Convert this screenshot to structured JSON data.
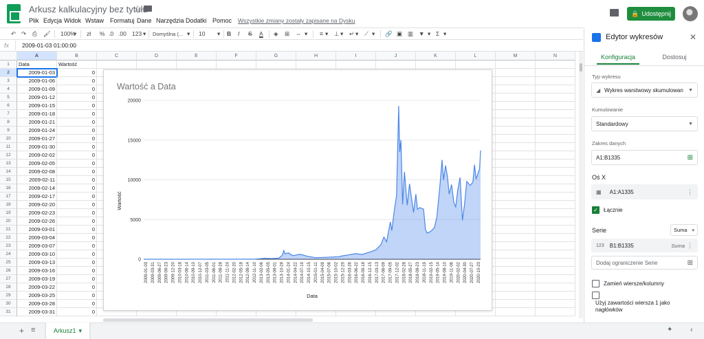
{
  "app": {
    "title": "Arkusz kalkulacyjny bez tytułu",
    "saved_status": "Wszystkie zmiany zostały zapisane na Dysku",
    "share_label": "Udostępnij",
    "menu": [
      "Plik",
      "Edycja",
      "Widok",
      "Wstaw",
      "Formatuj",
      "Dane",
      "Narzędzia",
      "Dodatki",
      "Pomoc"
    ]
  },
  "toolbar": {
    "zoom": "100%",
    "currency": "zł",
    "percent": "%",
    "dec_less": ".0",
    "dec_more": ".00",
    "format": "123",
    "font": "Domyślna (...",
    "font_size": "10",
    "bold": "B",
    "italic": "I",
    "strike": "S",
    "textcolor": "A",
    "sum": "Σ"
  },
  "formula_bar": {
    "fx": "fx",
    "value": "2009-01-03 01:00:00"
  },
  "grid": {
    "columns": [
      "A",
      "B",
      "C",
      "D",
      "E",
      "F",
      "G",
      "H",
      "I",
      "J",
      "K",
      "L",
      "M",
      "N"
    ],
    "header_row": [
      "Data",
      "Wartość"
    ],
    "rows": [
      [
        "2009-01-03",
        "0"
      ],
      [
        "2009-01-06",
        "0"
      ],
      [
        "2009-01-09",
        "0"
      ],
      [
        "2009-01-12",
        "0"
      ],
      [
        "2009-01-15",
        "0"
      ],
      [
        "2009-01-18",
        "0"
      ],
      [
        "2009-01-21",
        "0"
      ],
      [
        "2009-01-24",
        "0"
      ],
      [
        "2009-01-27",
        "0"
      ],
      [
        "2009-01-30",
        "0"
      ],
      [
        "2009-02-02",
        "0"
      ],
      [
        "2009-02-05",
        "0"
      ],
      [
        "2009-02-08",
        "0"
      ],
      [
        "2009-02-11",
        "0"
      ],
      [
        "2009-02-14",
        "0"
      ],
      [
        "2009-02-17",
        "0"
      ],
      [
        "2009-02-20",
        "0"
      ],
      [
        "2009-02-23",
        "0"
      ],
      [
        "2009-02-26",
        "0"
      ],
      [
        "2009-03-01",
        "0"
      ],
      [
        "2009-03-04",
        "0"
      ],
      [
        "2009-03-07",
        "0"
      ],
      [
        "2009-03-10",
        "0"
      ],
      [
        "2009-03-13",
        "0"
      ],
      [
        "2009-03-16",
        "0"
      ],
      [
        "2009-03-19",
        "0"
      ],
      [
        "2009-03-22",
        "0"
      ],
      [
        "2009-03-25",
        "0"
      ],
      [
        "2009-03-28",
        "0"
      ],
      [
        "2009-03-31",
        "0"
      ]
    ]
  },
  "chart_data": {
    "type": "area",
    "title": "Wartość a Data",
    "xlabel": "Data",
    "ylabel": "Wartość",
    "ylim": [
      0,
      20000
    ],
    "yticks": [
      "0",
      "5000",
      "10000",
      "15000",
      "20000"
    ],
    "grid": true,
    "color": "#4a86e8",
    "x_tick_labels": [
      "2009-01-03",
      "2009-03-31",
      "2009-06-27",
      "2009-09-23",
      "2009-12-20",
      "2010-03-18",
      "2010-06-14",
      "2010-09-10",
      "2010-12-07",
      "2011-03-05",
      "2011-06-01",
      "2011-08-28",
      "2011-11-24",
      "2012-02-20",
      "2012-05-18",
      "2012-08-14",
      "2012-11-10",
      "2013-02-06",
      "2013-05-05",
      "2013-08-01",
      "2013-10-28",
      "2014-01-24",
      "2014-04-22",
      "2014-07-19",
      "2014-10-15",
      "2015-01-11",
      "2015-04-09",
      "2015-07-06",
      "2015-10-02",
      "2015-12-29",
      "2016-03-26",
      "2016-06-22",
      "2016-09-18",
      "2016-12-15",
      "2017-03-13",
      "2017-06-09",
      "2017-09-05",
      "2017-12-02",
      "2018-02-28",
      "2018-05-27",
      "2018-08-23",
      "2018-11-19",
      "2019-02-15",
      "2019-05-14",
      "2019-08-10",
      "2019-11-06",
      "2020-02-02",
      "2020-04-30",
      "2020-07-27",
      "2020-10-23"
    ],
    "points": [
      [
        "2009-01-03",
        0
      ],
      [
        "2010-07-01",
        0
      ],
      [
        "2011-06-01",
        15
      ],
      [
        "2011-12-01",
        4
      ],
      [
        "2012-06-01",
        6
      ],
      [
        "2012-12-01",
        13
      ],
      [
        "2013-04-01",
        120
      ],
      [
        "2013-07-01",
        90
      ],
      [
        "2013-10-01",
        140
      ],
      [
        "2013-11-15",
        500
      ],
      [
        "2013-12-05",
        1100
      ],
      [
        "2013-12-20",
        700
      ],
      [
        "2014-02-01",
        800
      ],
      [
        "2014-04-01",
        450
      ],
      [
        "2014-07-01",
        620
      ],
      [
        "2014-10-01",
        380
      ],
      [
        "2015-01-15",
        200
      ],
      [
        "2015-06-01",
        240
      ],
      [
        "2015-11-01",
        320
      ],
      [
        "2016-01-01",
        430
      ],
      [
        "2016-06-15",
        700
      ],
      [
        "2016-09-01",
        600
      ],
      [
        "2016-12-31",
        960
      ],
      [
        "2017-03-01",
        1200
      ],
      [
        "2017-05-01",
        1800
      ],
      [
        "2017-06-10",
        2800
      ],
      [
        "2017-07-15",
        2200
      ],
      [
        "2017-09-01",
        4700
      ],
      [
        "2017-09-20",
        3600
      ],
      [
        "2017-10-20",
        6000
      ],
      [
        "2017-11-20",
        8000
      ],
      [
        "2017-12-17",
        19300
      ],
      [
        "2017-12-30",
        13500
      ],
      [
        "2018-01-15",
        15000
      ],
      [
        "2018-02-05",
        6900
      ],
      [
        "2018-03-01",
        11000
      ],
      [
        "2018-04-05",
        6800
      ],
      [
        "2018-05-05",
        9500
      ],
      [
        "2018-06-25",
        5900
      ],
      [
        "2018-07-25",
        8200
      ],
      [
        "2018-08-15",
        6300
      ],
      [
        "2018-09-15",
        6500
      ],
      [
        "2018-11-01",
        6300
      ],
      [
        "2018-11-25",
        3800
      ],
      [
        "2018-12-15",
        3300
      ],
      [
        "2019-02-01",
        3500
      ],
      [
        "2019-03-20",
        4000
      ],
      [
        "2019-04-20",
        5300
      ],
      [
        "2019-05-25",
        8700
      ],
      [
        "2019-06-26",
        12500
      ],
      [
        "2019-07-15",
        10000
      ],
      [
        "2019-08-10",
        11800
      ],
      [
        "2019-09-05",
        10300
      ],
      [
        "2019-09-25",
        8200
      ],
      [
        "2019-10-26",
        9400
      ],
      [
        "2019-11-25",
        7100
      ],
      [
        "2019-12-18",
        6600
      ],
      [
        "2020-01-15",
        8800
      ],
      [
        "2020-02-12",
        10300
      ],
      [
        "2020-03-13",
        4900
      ],
      [
        "2020-04-10",
        6900
      ],
      [
        "2020-05-08",
        9800
      ],
      [
        "2020-06-20",
        9300
      ],
      [
        "2020-07-25",
        9700
      ],
      [
        "2020-08-15",
        11900
      ],
      [
        "2020-09-05",
        10100
      ],
      [
        "2020-10-20",
        11400
      ],
      [
        "2020-11-01",
        13700
      ]
    ]
  },
  "panel": {
    "title": "Edytor wykresów",
    "tab_config": "Konfiguracja",
    "tab_custom": "Dostosuj",
    "chart_type_label": "Typ wykresu",
    "chart_type_value": "Wykres warstwowy skumulowan",
    "stacking_label": "Kumulowanie",
    "stacking_value": "Standardowy",
    "range_label": "Zakres danych",
    "range_value": "A1:B1335",
    "xaxis_title": "Oś X",
    "xaxis_value": "A1:A1335",
    "aggregate_label": "Łącznie",
    "series_title": "Serie",
    "series_agg": "Suma",
    "series_value": "B1:B1335",
    "series_value_agg": "Suma",
    "add_series_placeholder": "Dodaj ograniczenie Serie",
    "swap_label": "Zamień wiersze/kolumny",
    "header_label": "Użyj zawartości wiersza 1 jako nagłówków"
  },
  "sheet": {
    "tab_label": "Arkusz1"
  }
}
